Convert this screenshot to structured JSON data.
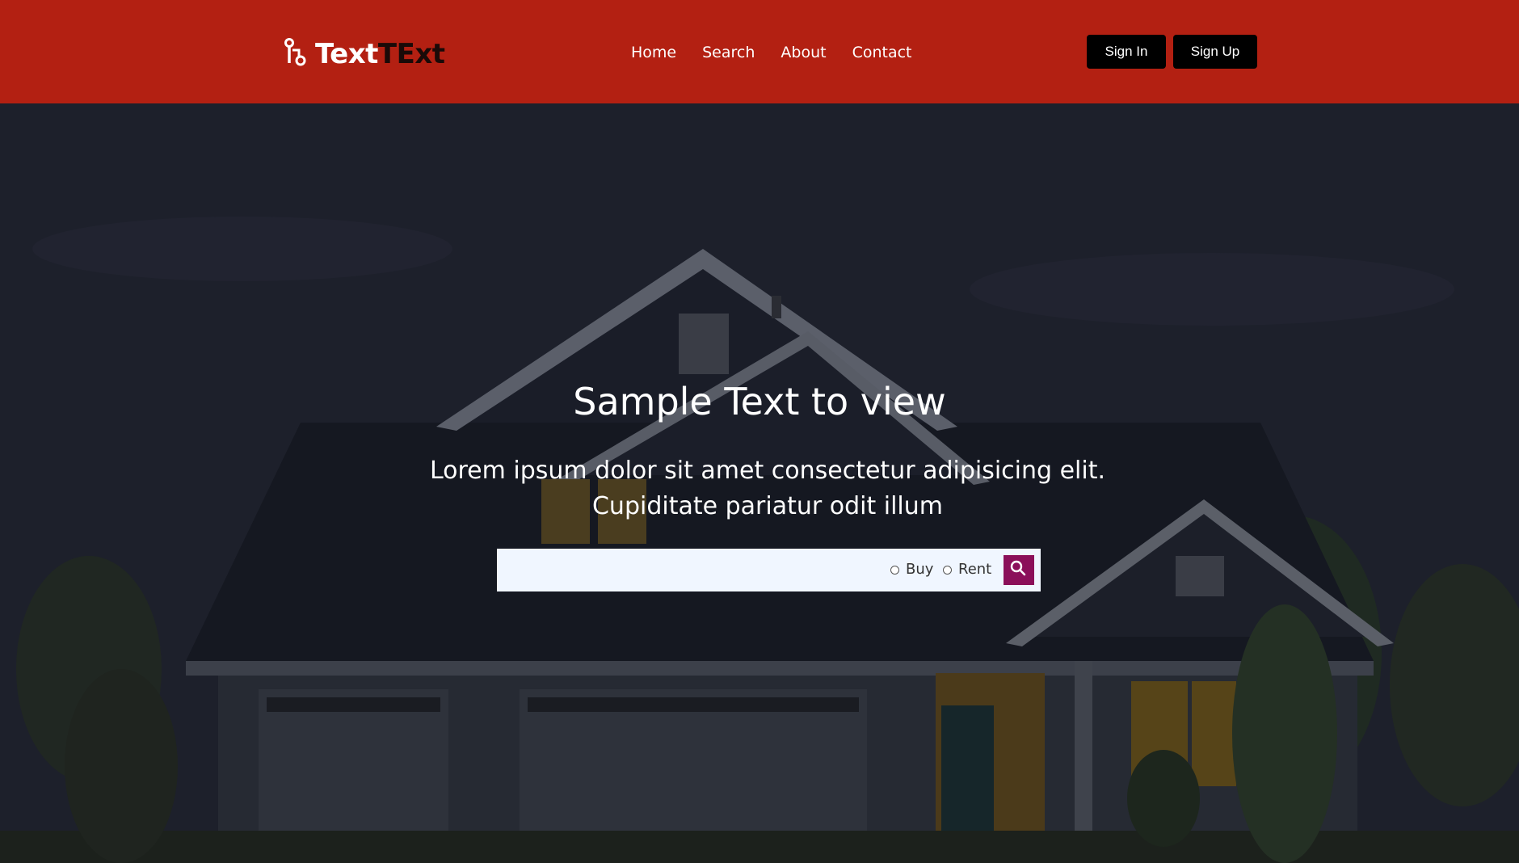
{
  "header": {
    "logo": {
      "part1": "Text",
      "part2": "TExt"
    },
    "nav": [
      {
        "label": "Home"
      },
      {
        "label": "Search"
      },
      {
        "label": "About"
      },
      {
        "label": "Contact"
      }
    ],
    "sign_in_label": "Sign In",
    "sign_up_label": "Sign Up",
    "background_color": "#b32012"
  },
  "hero": {
    "title": "Sample Text to view",
    "subtitle": "Lorem ipsum dolor sit amet consectetur adipisicing elit. Cupiditate pariatur odit illum",
    "background": "dark house-at-dusk photo",
    "search": {
      "value": "",
      "options": [
        {
          "label": "Buy",
          "checked": false
        },
        {
          "label": "Rent",
          "checked": false
        }
      ],
      "button_icon": "search-icon",
      "button_color": "#8b0f5a"
    }
  }
}
